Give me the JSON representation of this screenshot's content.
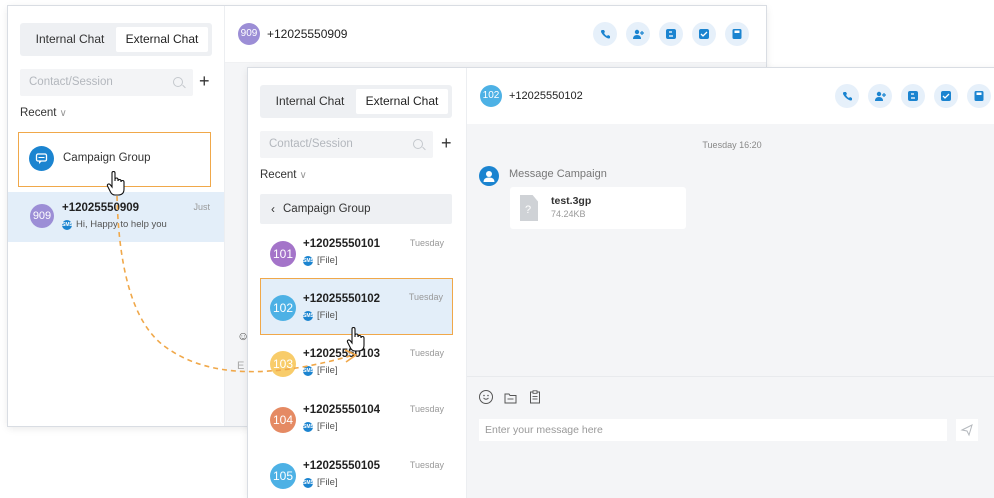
{
  "back": {
    "tabs": [
      "Internal Chat",
      "External Chat"
    ],
    "search_placeholder": "Contact/Session",
    "recent_label": "Recent",
    "campaign_group": "Campaign Group",
    "contact": {
      "avatar": "909",
      "number": "+12025550909",
      "time": "Just",
      "preview": "Hi, Happy to help you"
    },
    "header": {
      "avatar": "909",
      "number": "+12025550909"
    }
  },
  "front": {
    "tabs": [
      "Internal Chat",
      "External Chat"
    ],
    "search_placeholder": "Contact/Session",
    "recent_label": "Recent",
    "back_label": "Campaign Group",
    "contacts": [
      {
        "avatar": "101",
        "number": "+12025550101",
        "time": "Tuesday",
        "preview": "[File]",
        "color": "#a474c9"
      },
      {
        "avatar": "102",
        "number": "+12025550102",
        "time": "Tuesday",
        "preview": "[File]",
        "color": "#4db1e5"
      },
      {
        "avatar": "103",
        "number": "+12025550103",
        "time": "Tuesday",
        "preview": "[File]",
        "color": "#f8cc6a"
      },
      {
        "avatar": "104",
        "number": "+12025550104",
        "time": "Tuesday",
        "preview": "[File]",
        "color": "#e58a63"
      },
      {
        "avatar": "105",
        "number": "+12025550105",
        "time": "Tuesday",
        "preview": "[File]",
        "color": "#4db1e5"
      }
    ],
    "header": {
      "avatar": "102",
      "number": "+12025550102"
    },
    "timestamp": "Tuesday 16:20",
    "sender": "Message Campaign",
    "file": {
      "name": "test.3gp",
      "size": "74.24KB"
    },
    "composer_placeholder": "Enter your message here"
  },
  "colors": {
    "accent": "#1b84d0",
    "highlight": "#f0a84a",
    "selected_row": "#e3eef9",
    "icon_bg": "#e6f0fa"
  },
  "icons": [
    "phone-icon",
    "add-contact-icon",
    "transfer-icon",
    "note-icon",
    "save-icon",
    "emoji-icon",
    "folder-icon",
    "clipboard-icon",
    "send-icon",
    "file-icon",
    "pointer-hand-icon"
  ]
}
